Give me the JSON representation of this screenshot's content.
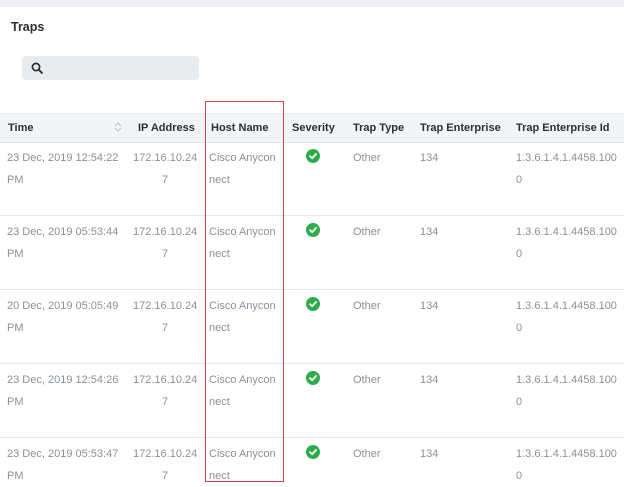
{
  "panel": {
    "title": "Traps"
  },
  "search": {
    "placeholder": "",
    "value": "",
    "icon": "search-icon"
  },
  "table": {
    "columns": [
      "Time",
      "IP Address",
      "Host Name",
      "Severity",
      "Trap Type",
      "Trap Enterprise",
      "Trap Enterprise Id"
    ],
    "rows": [
      {
        "time": [
          "23 Dec, 2019 12:54:22",
          "PM"
        ],
        "ip": [
          "172.16.10.24",
          "7"
        ],
        "host": [
          "Cisco Anycon",
          "nect"
        ],
        "severity": "check-circle-icon",
        "trap_type": "Other",
        "enterprise": "134",
        "enterprise_id": [
          "1.3.6.1.4.1.4458.100",
          "0"
        ]
      },
      {
        "time": [
          "23 Dec, 2019 05:53:44",
          "PM"
        ],
        "ip": [
          "172.16.10.24",
          "7"
        ],
        "host": [
          "Cisco Anycon",
          "nect"
        ],
        "severity": "check-circle-icon",
        "trap_type": "Other",
        "enterprise": "134",
        "enterprise_id": [
          "1.3.6.1.4.1.4458.100",
          "0"
        ]
      },
      {
        "time": [
          "20 Dec, 2019 05:05:49",
          "PM"
        ],
        "ip": [
          "172.16.10.24",
          "7"
        ],
        "host": [
          "Cisco Anycon",
          "nect"
        ],
        "severity": "check-circle-icon",
        "trap_type": "Other",
        "enterprise": "134",
        "enterprise_id": [
          "1.3.6.1.4.1.4458.100",
          "0"
        ]
      },
      {
        "time": [
          "23 Dec, 2019 12:54:26",
          "PM"
        ],
        "ip": [
          "172.16.10.24",
          "7"
        ],
        "host": [
          "Cisco Anycon",
          "nect"
        ],
        "severity": "check-circle-icon",
        "trap_type": "Other",
        "enterprise": "134",
        "enterprise_id": [
          "1.3.6.1.4.1.4458.100",
          "0"
        ]
      },
      {
        "time": [
          "23 Dec, 2019 05:53:47",
          "PM"
        ],
        "ip": [
          "172.16.10.24",
          "7"
        ],
        "host": [
          "Cisco Anycon",
          "nect"
        ],
        "severity": "check-circle-icon",
        "trap_type": "Other",
        "enterprise": "134",
        "enterprise_id": [
          "1.3.6.1.4.1.4458.100",
          "0"
        ]
      }
    ]
  },
  "colors": {
    "success": "#2eab4a",
    "highlight": "#d9414b",
    "header_bg": "#f2f4f6"
  }
}
